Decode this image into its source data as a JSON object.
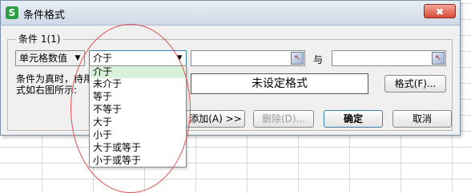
{
  "window": {
    "title": "条件格式",
    "app_icon_letter": "S",
    "close_symbol": "✖"
  },
  "condition_group": {
    "label": "条件 1(1)",
    "type_select": {
      "value": "单元格数值"
    },
    "operator_select": {
      "value": "介于"
    },
    "and_label": "与",
    "description": "条件为真时，待用格式如右图所示:",
    "preview_text": "未设定格式",
    "format_button": "格式(F)..."
  },
  "dropdown": {
    "options": [
      "介于",
      "未介于",
      "等于",
      "不等于",
      "大于",
      "小于",
      "大于或等于",
      "小于或等于"
    ],
    "selected_index": 0
  },
  "buttons": {
    "add": "添加(A) >>",
    "delete": "删除(D)...",
    "ok": "确定",
    "cancel": "取消"
  },
  "colors": {
    "selected_item": "#d9f0d9",
    "annotation": "#e05050",
    "app_icon": "#2e9e44"
  }
}
